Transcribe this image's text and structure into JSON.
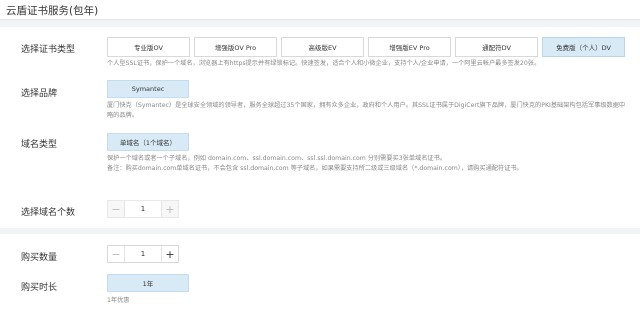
{
  "header": {
    "title": "云盾证书服务(包年)"
  },
  "cert_type": {
    "label": "选择证书类型",
    "options": [
      "专业版OV",
      "增强版OV Pro",
      "高级版EV",
      "增强版EV Pro",
      "通配符DV",
      "免费版（个人）DV"
    ],
    "selected": "免费版（个人）DV",
    "description": "个人型SSL证书，保护一个域名，浏览器上有https提示并有绿锁标记。快速签发，适合个人和小微企业，支持个人/企业申请，一个阿里云帐户最多签发20张。"
  },
  "brand": {
    "label": "选择品牌",
    "selected": "Symantec",
    "description_line1": "厦门快克（Symantec）是全球安全领域的领导者，服务全球超过35个国家，拥有众多企业，政府和个人用户。其SSL证书属于DigiCert旗下品牌，厦门快克的PKI基础架构包括军事级数据中",
    "description_line2": "略的品牌。"
  },
  "domain_type": {
    "label": "域名类型",
    "selected": "单域名（1个域名）",
    "description_line1": "保护一个域名或者一个子域名，例如 domain.com、ssl.domain.com、ssl.ssl.domain.com 分别需要买3张单域名证书。",
    "description_line2": "备注：购买domain.com单域名证书，不会包含 ssl.domain.com 等子域名，如果需要支持所二级或三级域名（*.domain.com），请购买通配符证书。"
  },
  "domain_count": {
    "label": "选择域名个数",
    "value": "1",
    "minus": "−",
    "plus": "+"
  },
  "quantity": {
    "label": "购买数量",
    "value": "1",
    "minus": "−",
    "plus": "+"
  },
  "duration": {
    "label": "购买时长",
    "selected": "1年",
    "note": "1年优惠"
  }
}
